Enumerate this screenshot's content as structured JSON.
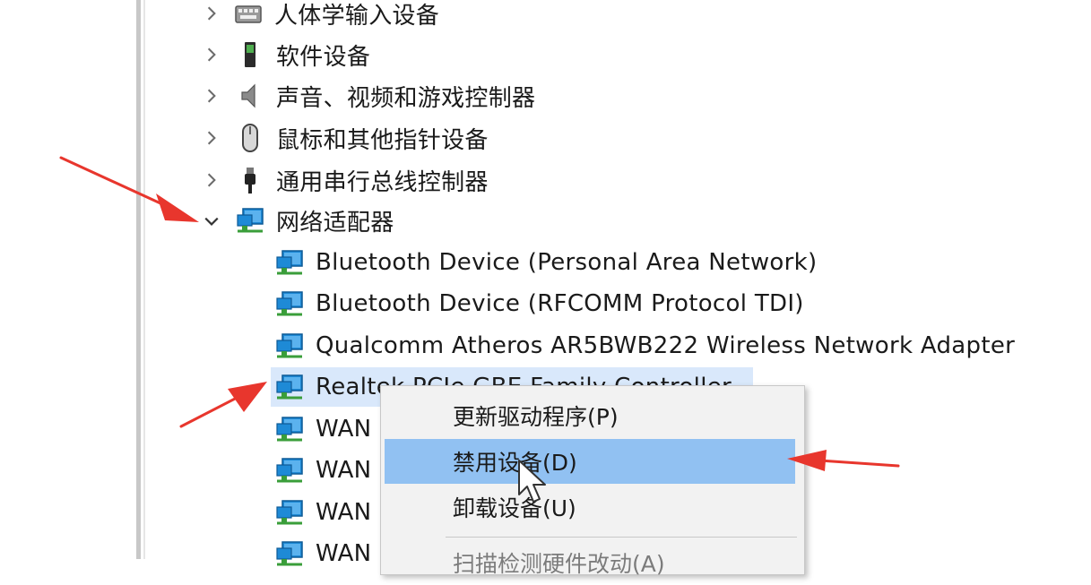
{
  "tree": {
    "categories": [
      {
        "label": "人体学输入设备",
        "icon": "hid-keyboard-icon",
        "expanded": false
      },
      {
        "label": "软件设备",
        "icon": "software-device-icon",
        "expanded": false
      },
      {
        "label": "声音、视频和游戏控制器",
        "icon": "speaker-icon",
        "expanded": false
      },
      {
        "label": "鼠标和其他指针设备",
        "icon": "mouse-icon",
        "expanded": false
      },
      {
        "label": "通用串行总线控制器",
        "icon": "usb-icon",
        "expanded": false
      },
      {
        "label": "网络适配器",
        "icon": "network-adapter-icon",
        "expanded": true
      }
    ],
    "network_children": [
      {
        "label": "Bluetooth Device (Personal Area Network)"
      },
      {
        "label": "Bluetooth Device (RFCOMM Protocol TDI)"
      },
      {
        "label": "Qualcomm Atheros AR5BWB222 Wireless Network Adapter"
      },
      {
        "label": "Realtek PCIe GBE Family Controller",
        "selected": true
      },
      {
        "label": "WAN"
      },
      {
        "label": "WAN"
      },
      {
        "label": "WAN"
      },
      {
        "label": "WAN"
      }
    ]
  },
  "context_menu": {
    "items": [
      {
        "label": "更新驱动程序(P)",
        "highlighted": false
      },
      {
        "label": "禁用设备(D)",
        "highlighted": true
      },
      {
        "label": "卸载设备(U)",
        "highlighted": false
      },
      {
        "label": "扫描检测硬件改动(A)",
        "highlighted": false
      }
    ]
  },
  "colors": {
    "arrow": "#e8362d",
    "menu_highlight": "#91c1f2",
    "row_selected": "#d9e8fb",
    "monitor_blue": "#1e8ad6",
    "cable_green": "#3a9e3a"
  }
}
